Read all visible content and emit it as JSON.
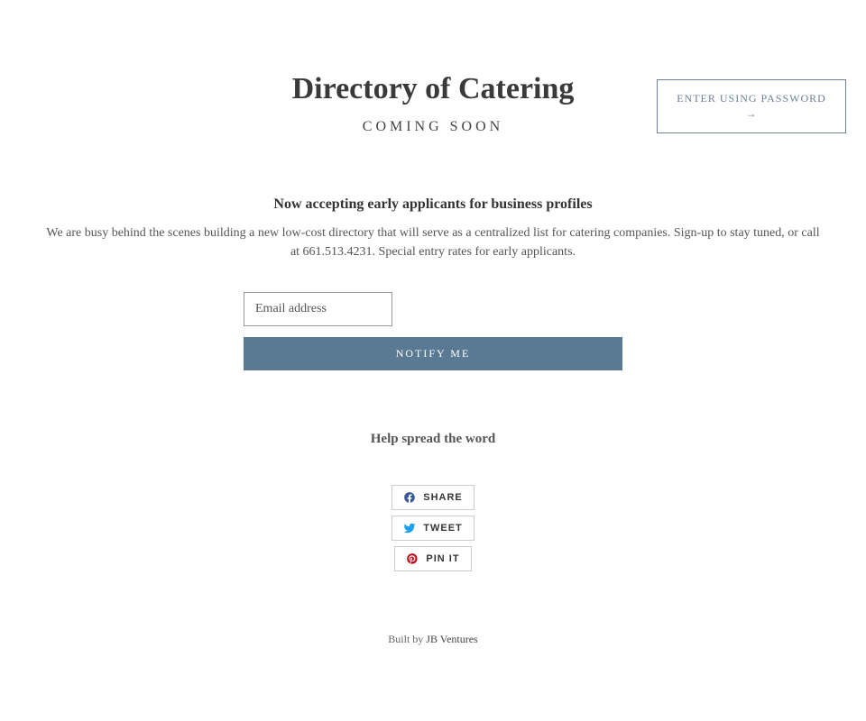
{
  "header": {
    "password_link": "ENTER USING PASSWORD →"
  },
  "page": {
    "title": "Directory of Catering",
    "coming_soon": "COMING SOON",
    "subtitle": "Now accepting early applicants for business profiles",
    "description": "We are busy behind the scenes building a new low-cost directory that will serve as a centralized list for catering companies. Sign-up to stay tuned, or call at 661.513.4231. Special entry rates for early applicants."
  },
  "form": {
    "email_placeholder": "Email address",
    "notify_label": "NOTIFY ME"
  },
  "spread": {
    "heading": "Help spread the word"
  },
  "social": {
    "share_label": "SHARE",
    "tweet_label": "TWEET",
    "pin_label": "PIN IT"
  },
  "footer": {
    "built_by": "Built by ",
    "vendor": "JB Ventures"
  }
}
